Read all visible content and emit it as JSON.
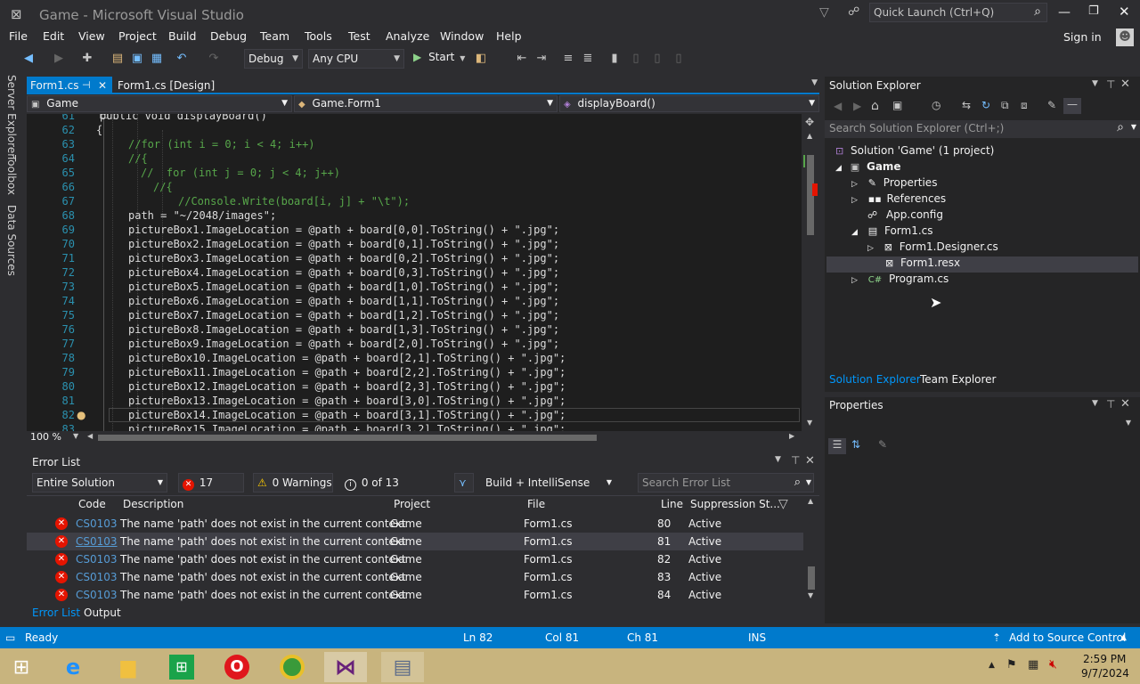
{
  "window": {
    "title": "Game - Microsoft Visual Studio",
    "quick_launch_placeholder": "Quick Launch (Ctrl+Q)",
    "sign_in": "Sign in"
  },
  "menu": [
    "File",
    "Edit",
    "View",
    "Project",
    "Build",
    "Debug",
    "Team",
    "Tools",
    "Test",
    "Analyze",
    "Window",
    "Help"
  ],
  "toolbar": {
    "config": "Debug",
    "platform": "Any CPU",
    "start_label": "Start"
  },
  "left_strip": [
    "Server Explorer",
    "Toolbox",
    "Data Sources"
  ],
  "editor": {
    "tabs": [
      {
        "label": "Form1.cs",
        "active": true
      },
      {
        "label": "Form1.cs [Design]",
        "active": false
      }
    ],
    "nav": {
      "project": "Game",
      "class": "Game.Form1",
      "member": "displayBoard()"
    },
    "zoom": "100 %",
    "lines": [
      {
        "n": "61",
        "text": "public void displayBoard()"
      },
      {
        "n": "62",
        "text": "{"
      },
      {
        "n": "63",
        "text": "//for (int i = 0; i < 4; i++)"
      },
      {
        "n": "64",
        "text": "//{"
      },
      {
        "n": "65",
        "text": "//  for (int j = 0; j < 4; j++)"
      },
      {
        "n": "66",
        "text": "//{"
      },
      {
        "n": "67",
        "text": "//Console.Write(board[i, j] + \"\\t\");"
      },
      {
        "n": "68",
        "text": "path = \"~/2048/images\";"
      },
      {
        "n": "69",
        "text": "pictureBox1.ImageLocation = @path + board[0,0].ToString() + \".jpg\";"
      },
      {
        "n": "70",
        "text": "pictureBox2.ImageLocation = @path + board[0,1].ToString() + \".jpg\";"
      },
      {
        "n": "71",
        "text": "pictureBox3.ImageLocation = @path + board[0,2].ToString() + \".jpg\";"
      },
      {
        "n": "72",
        "text": "pictureBox4.ImageLocation = @path + board[0,3].ToString() + \".jpg\";"
      },
      {
        "n": "73",
        "text": "pictureBox5.ImageLocation = @path + board[1,0].ToString() + \".jpg\";"
      },
      {
        "n": "74",
        "text": "pictureBox6.ImageLocation = @path + board[1,1].ToString() + \".jpg\";"
      },
      {
        "n": "75",
        "text": "pictureBox7.ImageLocation = @path + board[1,2].ToString() + \".jpg\";"
      },
      {
        "n": "76",
        "text": "pictureBox8.ImageLocation = @path + board[1,3].ToString() + \".jpg\";"
      },
      {
        "n": "77",
        "text": "pictureBox9.ImageLocation = @path + board[2,0].ToString() + \".jpg\";"
      },
      {
        "n": "78",
        "text": "pictureBox10.ImageLocation = @path + board[2,1].ToString() + \".jpg\";"
      },
      {
        "n": "79",
        "text": "pictureBox11.ImageLocation = @path + board[2,2].ToString() + \".jpg\";"
      },
      {
        "n": "80",
        "text": "pictureBox12.ImageLocation = @path + board[2,3].ToString() + \".jpg\";"
      },
      {
        "n": "81",
        "text": "pictureBox13.ImageLocation = @path + board[3,0].ToString() + \".jpg\";"
      },
      {
        "n": "82",
        "text": "pictureBox14.ImageLocation = @path + board[3,1].ToString() + \".jpg\";"
      },
      {
        "n": "83",
        "text": "pictureBox15.ImageLocation = @path + board[3,2].ToString() + \".jpg\";"
      }
    ]
  },
  "error_list": {
    "title": "Error List",
    "scope": "Entire Solution",
    "errors_label": "17 Errors",
    "warnings_label": "0 Warnings",
    "messages_label": "0 of 13 Messages",
    "build_filter": "Build + IntelliSense",
    "search_placeholder": "Search Error List",
    "columns": [
      "Code",
      "Description",
      "Project",
      "File",
      "Line",
      "Suppression St..."
    ],
    "rows": [
      {
        "code": "CS0103",
        "desc": "The name 'path' does not exist in the current context",
        "project": "Game",
        "file": "Form1.cs",
        "line": "80",
        "state": "Active"
      },
      {
        "code": "CS0103",
        "desc": "The name 'path' does not exist in the current context",
        "project": "Game",
        "file": "Form1.cs",
        "line": "81",
        "state": "Active"
      },
      {
        "code": "CS0103",
        "desc": "The name 'path' does not exist in the current context",
        "project": "Game",
        "file": "Form1.cs",
        "line": "82",
        "state": "Active"
      },
      {
        "code": "CS0103",
        "desc": "The name 'path' does not exist in the current context",
        "project": "Game",
        "file": "Form1.cs",
        "line": "83",
        "state": "Active"
      },
      {
        "code": "CS0103",
        "desc": "The name 'path' does not exist in the current context",
        "project": "Game",
        "file": "Form1.cs",
        "line": "84",
        "state": "Active"
      }
    ],
    "bottom_tabs": [
      "Error List",
      "Output"
    ]
  },
  "solution_explorer": {
    "title": "Solution Explorer",
    "search_placeholder": "Search Solution Explorer (Ctrl+;)",
    "tree": {
      "solution": "Solution 'Game' (1 project)",
      "project": "Game",
      "properties": "Properties",
      "references": "References",
      "appconfig": "App.config",
      "form1": "Form1.cs",
      "designer": "Form1.Designer.cs",
      "resx": "Form1.resx",
      "program": "Program.cs"
    },
    "tabs": [
      "Solution Explorer",
      "Team Explorer"
    ]
  },
  "properties": {
    "title": "Properties"
  },
  "status": {
    "ready": "Ready",
    "ln": "Ln 82",
    "col": "Col 81",
    "ch": "Ch 81",
    "ins": "INS",
    "source_control": "Add to Source Control"
  },
  "taskbar": {
    "time": "2:59 PM",
    "date": "9/7/2024"
  },
  "colors": {
    "accent": "#007acc",
    "error": "#e51400",
    "comment": "#57a64a",
    "keyword": "#569cd6",
    "string": "#d69d85",
    "linenum": "#2b91af"
  }
}
